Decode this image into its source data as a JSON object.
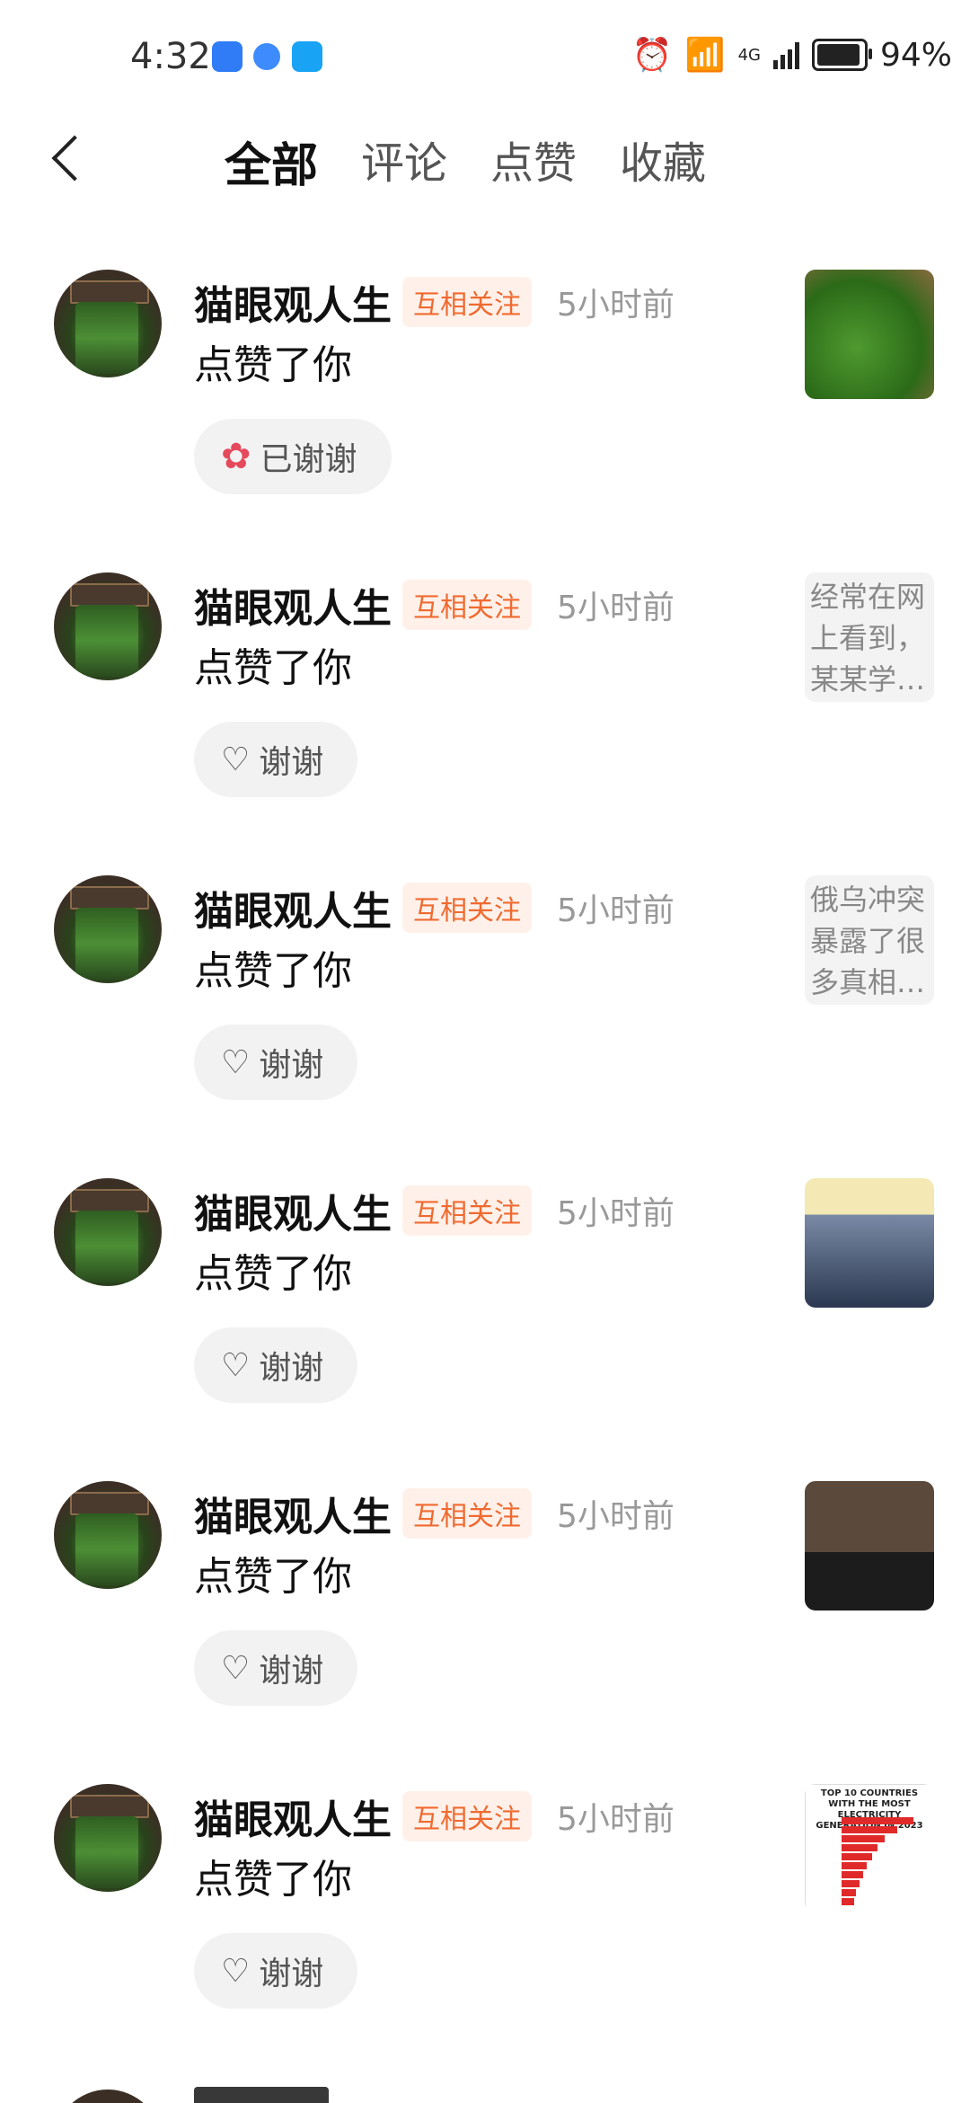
{
  "status_bar": {
    "time": "4:32",
    "battery": "94%",
    "battery_level": 0.94,
    "network": "4G"
  },
  "nav": {
    "tabs": [
      {
        "label": "全部",
        "active": true
      },
      {
        "label": "评论",
        "active": false
      },
      {
        "label": "点赞",
        "active": false
      },
      {
        "label": "收藏",
        "active": false
      }
    ]
  },
  "items": [
    {
      "name": "猫眼观人生",
      "badge": "互相关注",
      "ago": "5小时前",
      "action": "点赞了你",
      "button": "已谢谢",
      "thanked": true,
      "thumb_type": "image",
      "thumb_text": ""
    },
    {
      "name": "猫眼观人生",
      "badge": "互相关注",
      "ago": "5小时前",
      "action": "点赞了你",
      "button": "谢谢",
      "thanked": false,
      "thumb_type": "text",
      "thumb_text": "经常在网上看到，某某学…"
    },
    {
      "name": "猫眼观人生",
      "badge": "互相关注",
      "ago": "5小时前",
      "action": "点赞了你",
      "button": "谢谢",
      "thanked": false,
      "thumb_type": "text",
      "thumb_text": "俄乌冲突暴露了很多真相…"
    },
    {
      "name": "猫眼观人生",
      "badge": "互相关注",
      "ago": "5小时前",
      "action": "点赞了你",
      "button": "谢谢",
      "thanked": false,
      "thumb_type": "image",
      "thumb_text": ""
    },
    {
      "name": "猫眼观人生",
      "badge": "互相关注",
      "ago": "5小时前",
      "action": "点赞了你",
      "button": "谢谢",
      "thanked": false,
      "thumb_type": "image",
      "thumb_text": ""
    },
    {
      "name": "猫眼观人生",
      "badge": "互相关注",
      "ago": "5小时前",
      "action": "点赞了你",
      "button": "谢谢",
      "thanked": false,
      "thumb_type": "image",
      "thumb_text": ""
    }
  ],
  "thumb_styles": [
    "t-veg",
    "text",
    "text",
    "t-people",
    "t-tv",
    "t-chart"
  ],
  "chart_thumb_caption": "TOP 10 COUNTRIES WITH THE MOST ELECTRICITY GENERATION IN 2023"
}
